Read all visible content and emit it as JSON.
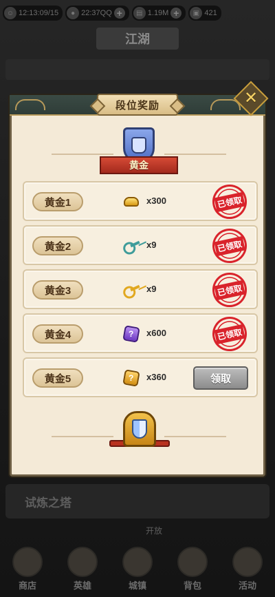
{
  "background": {
    "topbar": {
      "resources": [
        {
          "icon": "avatar-icon",
          "value": "12:13:09/15",
          "has_plus": false
        },
        {
          "icon": "coin-icon",
          "value": "22:37QQ",
          "has_plus": true
        },
        {
          "icon": "scroll-icon",
          "value": "1.19M",
          "has_plus": true
        },
        {
          "icon": "chest-icon",
          "value": "421",
          "has_plus": false
        }
      ]
    },
    "page_title": "江湖",
    "tower_label": "试炼之塔",
    "open_label": "开放",
    "nav": [
      {
        "label": "商店",
        "icon": "shop-icon"
      },
      {
        "label": "英雄",
        "icon": "hero-icon"
      },
      {
        "label": "城镇",
        "icon": "town-icon"
      },
      {
        "label": "背包",
        "icon": "bag-icon"
      },
      {
        "label": "活动",
        "icon": "event-icon"
      }
    ]
  },
  "modal": {
    "title": "段位奖励",
    "close_icon": "close-icon",
    "rank": {
      "name": "黄金",
      "badge_icon": "fist-badge-icon"
    },
    "colors": {
      "stamp_red": "#d9232b",
      "panel_bg": "#f4ead7",
      "ribbon_red": "#c0392b"
    },
    "rewards": [
      {
        "tier": "黄金1",
        "icon": "gold-ingot-icon",
        "qty": "x300",
        "status": "claimed",
        "stamp": "已领取"
      },
      {
        "tier": "黄金2",
        "icon": "teal-key-icon",
        "qty": "x9",
        "status": "claimed",
        "stamp": "已领取"
      },
      {
        "tier": "黄金3",
        "icon": "gold-key-icon",
        "qty": "x9",
        "status": "claimed",
        "stamp": "已领取"
      },
      {
        "tier": "黄金4",
        "icon": "purple-gem-icon",
        "qty": "x600",
        "status": "claimed",
        "stamp": "已领取"
      },
      {
        "tier": "黄金5",
        "icon": "gold-gem-icon",
        "qty": "x360",
        "status": "available",
        "button": "领取"
      }
    ],
    "next_rank_icon": "sword-shield-icon"
  }
}
